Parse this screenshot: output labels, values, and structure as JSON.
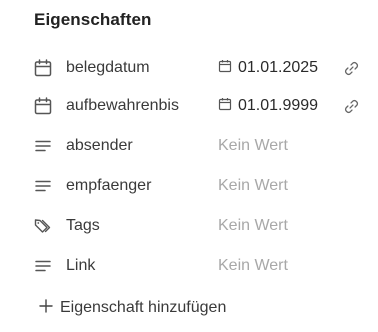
{
  "panel": {
    "title": "Eigenschaften",
    "properties": [
      {
        "icon": "calendar-icon",
        "label": "belegdatum",
        "value": "01.01.2025",
        "type": "date",
        "has_link": true
      },
      {
        "icon": "calendar-icon",
        "label": "aufbewahrenbis",
        "value": "01.01.9999",
        "type": "date",
        "has_link": true
      },
      {
        "icon": "text-lines-icon",
        "label": "absender",
        "value": "Kein Wert",
        "type": "empty",
        "has_link": false
      },
      {
        "icon": "text-lines-icon",
        "label": "empfaenger",
        "value": "Kein Wert",
        "type": "empty",
        "has_link": false
      },
      {
        "icon": "tags-icon",
        "label": "Tags",
        "value": "Kein Wert",
        "type": "empty",
        "has_link": false
      },
      {
        "icon": "text-lines-icon",
        "label": "Link",
        "value": "Kein Wert",
        "type": "empty",
        "has_link": false
      }
    ],
    "add_label": "Eigenschaft hinzufügen"
  },
  "colors": {
    "text": "#3a3a3a",
    "muted": "#a8a8a8",
    "icon": "#555555"
  }
}
